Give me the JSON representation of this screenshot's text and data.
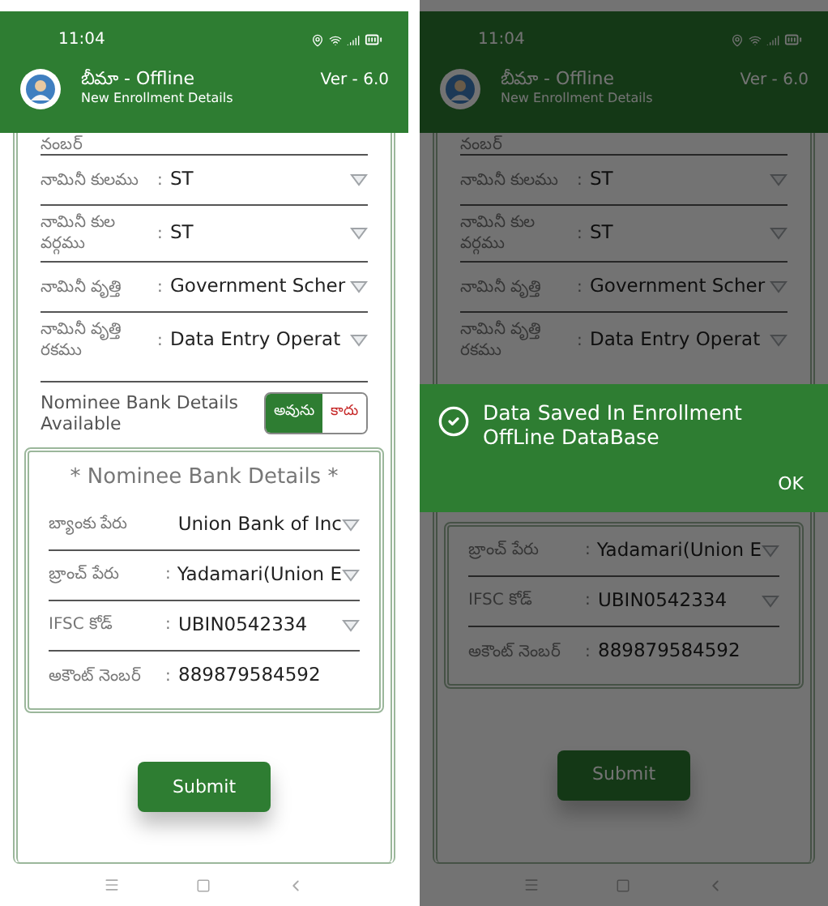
{
  "screens": [
    {
      "dimmed": false,
      "status_bar": {
        "time": "11:04"
      },
      "app_bar": {
        "title": "బీమా - Offline",
        "subtitle": "New Enrollment Details",
        "version": "Ver - 6.0"
      },
      "partial_label": "నంబర్",
      "nominee_rows": [
        {
          "label": "నామినీ కులము",
          "separator": ":",
          "value": "ST",
          "dropdown": true
        },
        {
          "label": "నామినీ కుల వర్గము",
          "separator": ":",
          "value": "ST",
          "dropdown": true
        },
        {
          "label": "నామినీ వృత్తి",
          "separator": ":",
          "value": "Government Scher",
          "dropdown": true
        },
        {
          "label": "నామినీ వృత్తి రకము",
          "separator": ":",
          "value": "Data Entry Operat",
          "dropdown": true
        }
      ],
      "bank_available": {
        "label": "Nominee Bank Details Available",
        "options": [
          {
            "label": "అవును",
            "selected": true
          },
          {
            "label": "కాదు",
            "selected": false
          }
        ]
      },
      "bank_section": {
        "title": "* Nominee Bank Details *",
        "rows": [
          {
            "label": "బ్యాంకు పేరు",
            "value": "Union Bank of Inc",
            "dropdown": true
          },
          {
            "label": "బ్రాంచ్ పేరు",
            "separator": ":",
            "value": "Yadamari(Union E",
            "dropdown": true
          },
          {
            "label": "IFSC కోడ్",
            "separator": ":",
            "value": "UBIN0542334",
            "dropdown": true
          },
          {
            "label": "అకౌంట్ నెంబర్",
            "separator": ":",
            "value": "889879584592",
            "dropdown": false
          }
        ]
      },
      "submit": "Submit"
    },
    {
      "dimmed": true,
      "status_bar": {
        "time": "11:04"
      },
      "app_bar": {
        "title": "బీమా - Offline",
        "subtitle": "New Enrollment Details",
        "version": "Ver - 6.0"
      },
      "partial_label": "నంబర్",
      "nominee_rows": [
        {
          "label": "నామినీ కులము",
          "separator": ":",
          "value": "ST",
          "dropdown": true
        },
        {
          "label": "నామినీ కుల వర్గము",
          "separator": ":",
          "value": "ST",
          "dropdown": true
        },
        {
          "label": "నామినీ వృత్తి",
          "separator": ":",
          "value": "Government Scher",
          "dropdown": true
        },
        {
          "label": "నామినీ వృత్తి రకము",
          "separator": ":",
          "value": "Data Entry Operat",
          "dropdown": true
        }
      ],
      "dialog": {
        "message": "Data Saved In Enrollment OffLine DataBase",
        "button": "OK"
      },
      "bank_section": {
        "rows": [
          {
            "label": "బ్రాంచ్ పేరు",
            "separator": ":",
            "value": "Yadamari(Union E",
            "dropdown": true
          },
          {
            "label": "IFSC కోడ్",
            "separator": ":",
            "value": "UBIN0542334",
            "dropdown": true
          },
          {
            "label": "అకౌంట్ నెంబర్",
            "separator": ":",
            "value": "889879584592",
            "dropdown": false
          }
        ]
      },
      "submit": "Submit"
    }
  ]
}
